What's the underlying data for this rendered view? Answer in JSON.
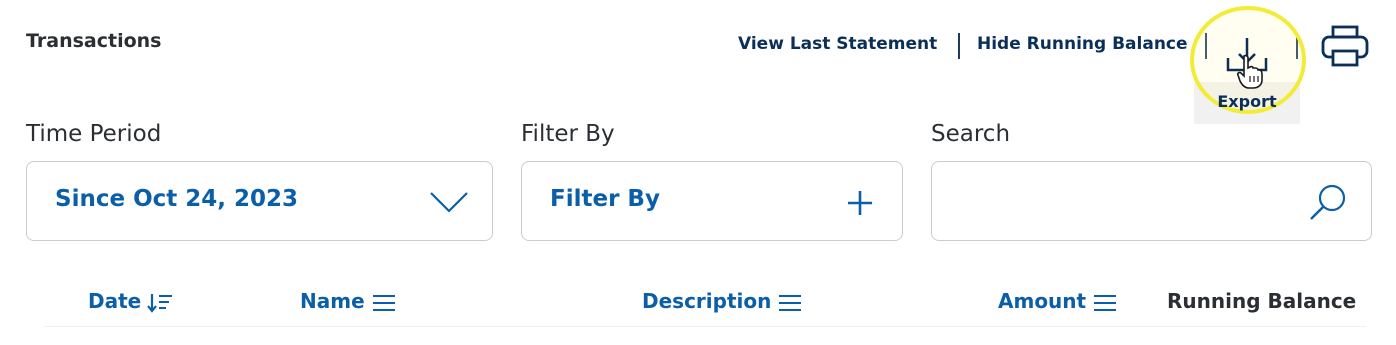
{
  "header": {
    "title": "Transactions",
    "view_last_statement": "View Last Statement",
    "hide_running_balance": "Hide Running Balance",
    "export_label": "Export"
  },
  "filters": {
    "time_period": {
      "label": "Time Period",
      "value": "Since Oct 24, 2023"
    },
    "filter_by": {
      "label": "Filter By",
      "value": "Filter By"
    },
    "search": {
      "label": "Search",
      "value": ""
    }
  },
  "columns": [
    {
      "label": "Date"
    },
    {
      "label": "Name"
    },
    {
      "label": "Description"
    },
    {
      "label": "Amount"
    },
    {
      "label": "Running Balance"
    }
  ],
  "colors": {
    "link_navy": "#0b2f57",
    "accent_blue": "#0b5ea8",
    "highlight_yellow": "#f2ec38"
  },
  "icons": [
    "download-icon",
    "print-icon",
    "chevron-down-icon",
    "plus-icon",
    "search-icon",
    "sort-desc-icon",
    "menu-lines-icon",
    "hand-cursor-icon"
  ]
}
